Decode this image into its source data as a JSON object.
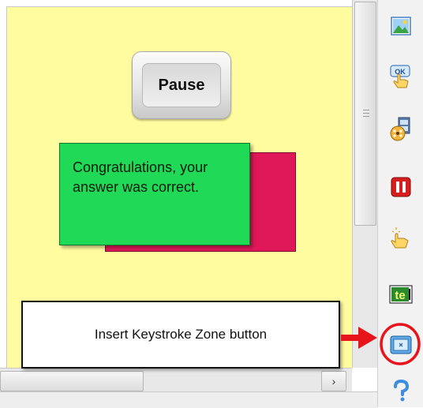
{
  "canvas": {
    "pause_button_label": "Pause",
    "caption_text": "Congratulations, your answer was correct."
  },
  "callout": {
    "text": "Insert Keystroke Zone button"
  },
  "toolbar": {
    "items": [
      {
        "name": "insert-image",
        "icon": "image-icon"
      },
      {
        "name": "insert-button",
        "icon": "ok-button-hand-icon",
        "label": "OK"
      },
      {
        "name": "insert-animation",
        "icon": "film-reel-icon"
      },
      {
        "name": "insert-pause",
        "icon": "pause-icon"
      },
      {
        "name": "insert-click-zone",
        "icon": "pointing-hand-icon"
      },
      {
        "name": "insert-text-entry",
        "icon": "text-entry-icon",
        "label": "te"
      },
      {
        "name": "insert-keystroke-zone",
        "icon": "keystroke-zone-icon"
      },
      {
        "name": "help",
        "icon": "help-icon"
      }
    ]
  },
  "colors": {
    "stage": "#fffca0",
    "caption_green": "#1fd957",
    "caption_shadow": "#e0185a",
    "callout_red": "#e8141b"
  },
  "scrollbar": {
    "right_arrow": "›"
  }
}
